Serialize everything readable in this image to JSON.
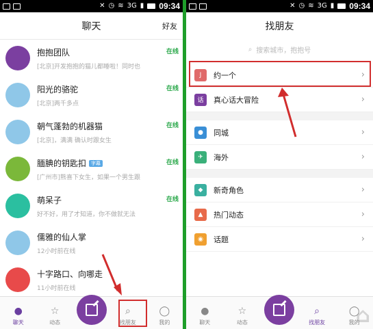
{
  "status_bar": {
    "time": "09:34",
    "network": "3G"
  },
  "left": {
    "title": "聊天",
    "friends_label": "好友",
    "chats": [
      {
        "name": "抱抱团队",
        "badge": "",
        "sub": "[北京]开发抱抱的猫儿都睡啦！同时也",
        "online": "在线",
        "avatar_color": "#7b3fa0"
      },
      {
        "name": "阳光的骆驼",
        "badge": "",
        "sub": "[北京]两千多点",
        "online": "在线",
        "avatar_color": "#8fc7e8"
      },
      {
        "name": "朝气蓬勃的机器猫",
        "badge": "",
        "sub": "[北京]，满满 确认时跟女生",
        "online": "在线",
        "avatar_color": "#8fc7e8"
      },
      {
        "name": "腼腆的钥匙扣",
        "badge": "字幕",
        "sub": "[广州市]熊喜下女生，如果一个男生跟",
        "online": "在线",
        "avatar_color": "#7bb83a"
      },
      {
        "name": "萌呆子",
        "badge": "",
        "sub": "好不好，用了才知道，你不做就无法",
        "online": "在线",
        "avatar_color": "#2bbfa0"
      },
      {
        "name": "儒雅的仙人掌",
        "badge": "",
        "sub": "12小时前在线",
        "online": "",
        "avatar_color": "#8fc7e8"
      },
      {
        "name": "十字路口、向哪走",
        "badge": "",
        "sub": "11小时前在线",
        "online": "",
        "avatar_color": "#e84a4a"
      }
    ],
    "tabs": [
      {
        "label": "聊天",
        "icon": "chat-icon"
      },
      {
        "label": "动态",
        "icon": "star-icon"
      },
      {
        "label": "",
        "icon": "compose-icon"
      },
      {
        "label": "找朋友",
        "icon": "search-icon"
      },
      {
        "label": "我的",
        "icon": "profile-icon"
      }
    ]
  },
  "right": {
    "title": "找朋友",
    "search_placeholder": "搜索城市，抱抱号",
    "items": [
      {
        "label": "约一个",
        "icon": "hook-icon",
        "color": "#e06a6a"
      },
      {
        "label": "真心话大冒险",
        "icon": "truth-icon",
        "color": "#7b3fa0"
      },
      {
        "label": "同城",
        "icon": "location-icon",
        "color": "#3a8fd6"
      },
      {
        "label": "海外",
        "icon": "plane-icon",
        "color": "#3ab07a"
      },
      {
        "label": "新奇角色",
        "icon": "ghost-icon",
        "color": "#3ab0a0"
      },
      {
        "label": "热门动态",
        "icon": "fire-icon",
        "color": "#e86a4a"
      },
      {
        "label": "话题",
        "icon": "pin-icon",
        "color": "#f0a030"
      }
    ],
    "tabs": [
      {
        "label": "聊天",
        "icon": "chat-icon"
      },
      {
        "label": "动态",
        "icon": "star-icon"
      },
      {
        "label": "",
        "icon": "compose-icon"
      },
      {
        "label": "找朋友",
        "icon": "search-icon"
      },
      {
        "label": "我的",
        "icon": "profile-icon"
      }
    ]
  },
  "colors": {
    "accent": "#7b3fa0",
    "online": "#2aa84a",
    "highlight": "#d12d2d"
  }
}
